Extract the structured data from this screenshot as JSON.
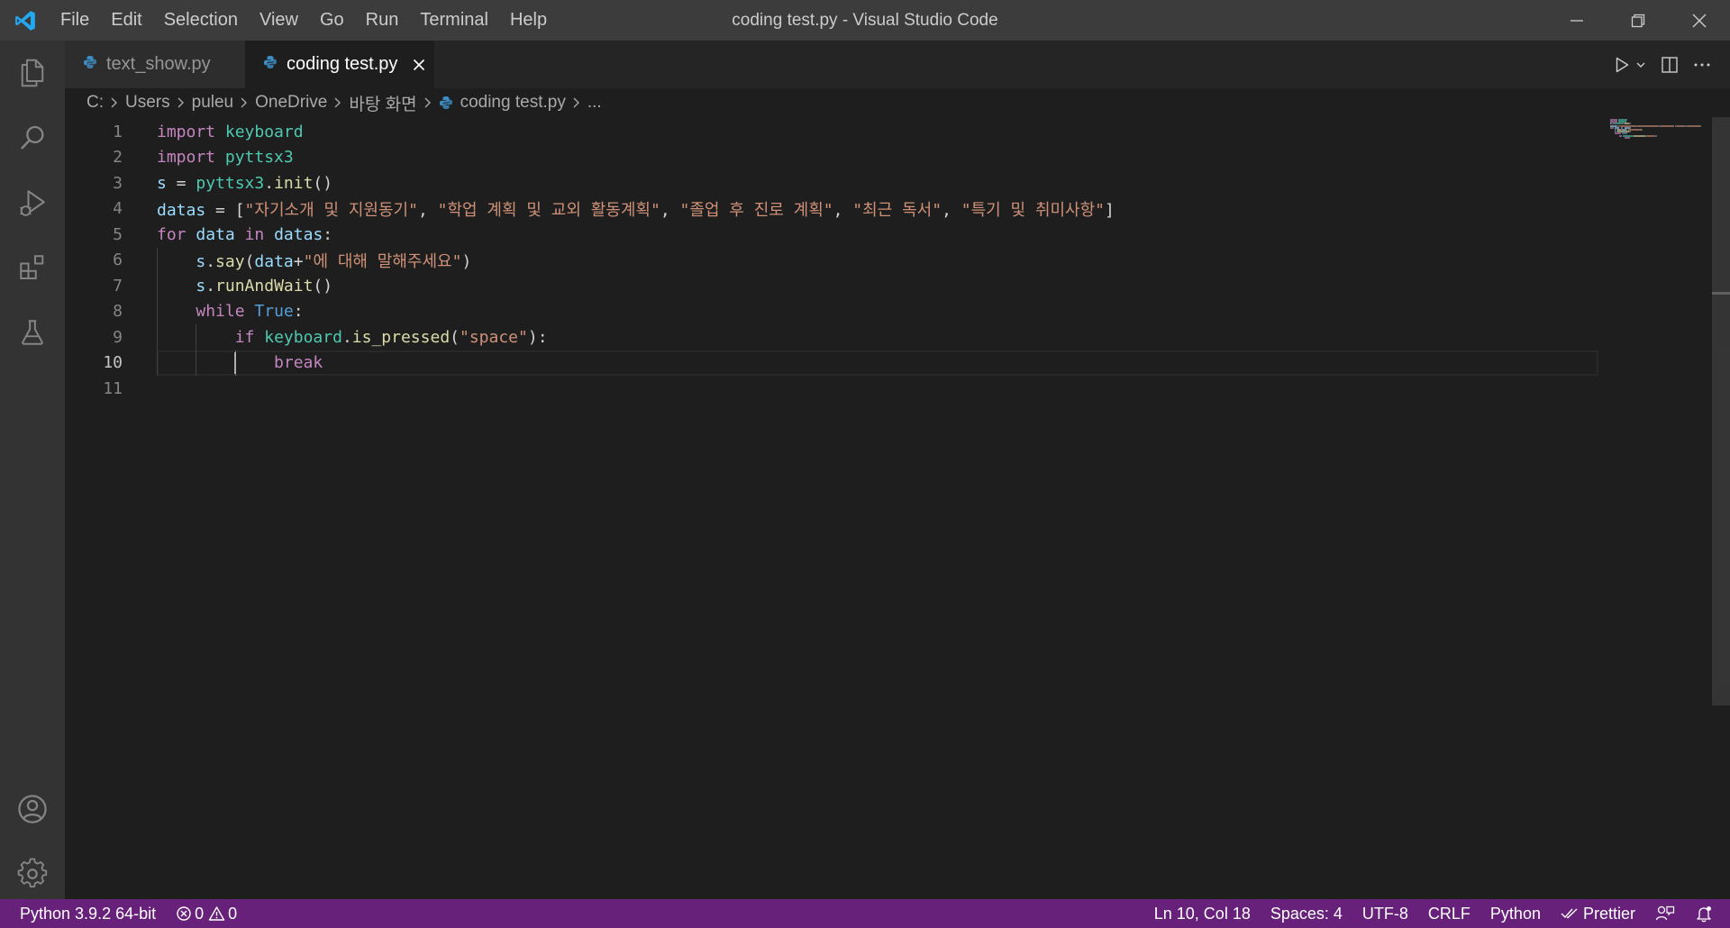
{
  "window": {
    "title": "coding test.py - Visual Studio Code"
  },
  "menu": {
    "items": [
      {
        "label": "File"
      },
      {
        "label": "Edit"
      },
      {
        "label": "Selection"
      },
      {
        "label": "View"
      },
      {
        "label": "Go"
      },
      {
        "label": "Run"
      },
      {
        "label": "Terminal"
      },
      {
        "label": "Help"
      }
    ]
  },
  "activity_bar": {
    "icons": [
      "explorer-icon",
      "search-icon",
      "run-debug-icon",
      "extensions-icon",
      "testing-icon",
      "accounts-icon",
      "manage-gear-icon"
    ]
  },
  "tabs": [
    {
      "label": "text_show.py",
      "active": false
    },
    {
      "label": "coding test.py",
      "active": true
    }
  ],
  "breadcrumb": {
    "items": [
      "C:",
      "Users",
      "puleu",
      "OneDrive",
      "바탕 화면",
      "coding test.py",
      "..."
    ]
  },
  "editor": {
    "current_line": 10,
    "line_numbers": [
      "1",
      "2",
      "3",
      "4",
      "5",
      "6",
      "7",
      "8",
      "9",
      "10",
      "11"
    ],
    "lines": [
      [
        {
          "t": "import",
          "c": "kw"
        },
        {
          "t": " ",
          "c": "op"
        },
        {
          "t": "keyboard",
          "c": "mod"
        }
      ],
      [
        {
          "t": "import",
          "c": "kw"
        },
        {
          "t": " ",
          "c": "op"
        },
        {
          "t": "pyttsx3",
          "c": "mod"
        }
      ],
      [
        {
          "t": "s",
          "c": "var"
        },
        {
          "t": " = ",
          "c": "op"
        },
        {
          "t": "pyttsx3",
          "c": "mod"
        },
        {
          "t": ".",
          "c": "op"
        },
        {
          "t": "init",
          "c": "fn"
        },
        {
          "t": "()",
          "c": "op"
        }
      ],
      [
        {
          "t": "datas",
          "c": "var"
        },
        {
          "t": " = [",
          "c": "op"
        },
        {
          "t": "\"자기소개 및 지원동기\"",
          "c": "str"
        },
        {
          "t": ", ",
          "c": "op"
        },
        {
          "t": "\"학업 계획 및 교외 활동계획\"",
          "c": "str"
        },
        {
          "t": ", ",
          "c": "op"
        },
        {
          "t": "\"졸업 후 진로 계획\"",
          "c": "str"
        },
        {
          "t": ", ",
          "c": "op"
        },
        {
          "t": "\"최근 독서\"",
          "c": "str"
        },
        {
          "t": ", ",
          "c": "op"
        },
        {
          "t": "\"특기 및 취미사항\"",
          "c": "str"
        },
        {
          "t": "]",
          "c": "op"
        }
      ],
      [
        {
          "t": "for",
          "c": "kw"
        },
        {
          "t": " ",
          "c": "op"
        },
        {
          "t": "data",
          "c": "var"
        },
        {
          "t": " ",
          "c": "op"
        },
        {
          "t": "in",
          "c": "kw"
        },
        {
          "t": " ",
          "c": "op"
        },
        {
          "t": "datas",
          "c": "var"
        },
        {
          "t": ":",
          "c": "op"
        }
      ],
      [
        {
          "t": "    ",
          "c": "op"
        },
        {
          "t": "s",
          "c": "var"
        },
        {
          "t": ".",
          "c": "op"
        },
        {
          "t": "say",
          "c": "fn"
        },
        {
          "t": "(",
          "c": "op"
        },
        {
          "t": "data",
          "c": "var"
        },
        {
          "t": "+",
          "c": "op"
        },
        {
          "t": "\"에 대해 말해주세요\"",
          "c": "str"
        },
        {
          "t": ")",
          "c": "op"
        }
      ],
      [
        {
          "t": "    ",
          "c": "op"
        },
        {
          "t": "s",
          "c": "var"
        },
        {
          "t": ".",
          "c": "op"
        },
        {
          "t": "runAndWait",
          "c": "fn"
        },
        {
          "t": "()",
          "c": "op"
        }
      ],
      [
        {
          "t": "    ",
          "c": "op"
        },
        {
          "t": "while",
          "c": "kw"
        },
        {
          "t": " ",
          "c": "op"
        },
        {
          "t": "True",
          "c": "bl"
        },
        {
          "t": ":",
          "c": "op"
        }
      ],
      [
        {
          "t": "        ",
          "c": "op"
        },
        {
          "t": "if",
          "c": "kw"
        },
        {
          "t": " ",
          "c": "op"
        },
        {
          "t": "keyboard",
          "c": "mod"
        },
        {
          "t": ".",
          "c": "op"
        },
        {
          "t": "is_pressed",
          "c": "fn"
        },
        {
          "t": "(",
          "c": "op"
        },
        {
          "t": "\"space\"",
          "c": "str"
        },
        {
          "t": "):",
          "c": "op"
        }
      ],
      [
        {
          "t": "            ",
          "c": "op"
        },
        {
          "t": "break",
          "c": "kw"
        }
      ],
      []
    ]
  },
  "statusbar": {
    "interpreter": "Python 3.9.2 64-bit",
    "errors": "0",
    "warnings": "0",
    "cursor_position": "Ln 10, Col 18",
    "indentation": "Spaces: 4",
    "encoding": "UTF-8",
    "eol": "CRLF",
    "language": "Python",
    "formatter": "Prettier"
  },
  "colors": {
    "statusbar_bg": "#68217a",
    "titlebar_bg": "#3c3c3c",
    "editor_bg": "#1e1e1e",
    "activitybar_bg": "#333333",
    "accent": "#007acc"
  }
}
